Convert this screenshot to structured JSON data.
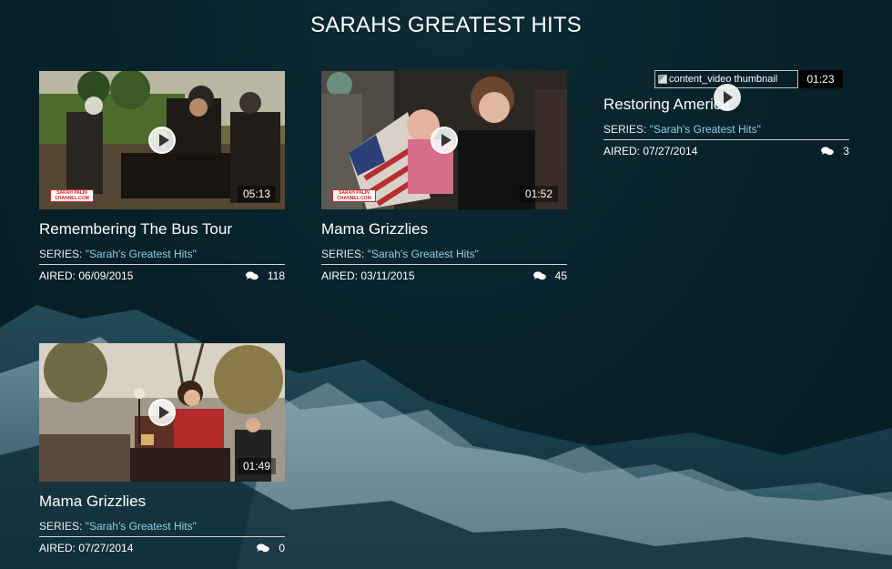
{
  "page": {
    "title": "SARAHS GREATEST HITS"
  },
  "videos": [
    {
      "title": "Remembering The Bus Tour",
      "duration": "05:13",
      "series_label": "SERIES:",
      "series": "\"Sarah's Greatest Hits\"",
      "aired": "AIRED: 06/09/2015",
      "comments": "118",
      "channel_logo": "SARAH PALIN CHANNEL.COM"
    },
    {
      "title": "Mama Grizzlies",
      "duration": "01:52",
      "series_label": "SERIES:",
      "series": "\"Sarah's Greatest Hits\"",
      "aired": "AIRED: 03/11/2015",
      "comments": "45",
      "channel_logo": "SARAH PALIN CHANNEL.COM"
    },
    {
      "title": "Restoring America",
      "duration": "01:23",
      "thumbnail_alt": "content_video thumbnail",
      "series_label": "SERIES:",
      "series": "\"Sarah's Greatest Hits\"",
      "aired": "AIRED: 07/27/2014",
      "comments": "3"
    },
    {
      "title": "Mama Grizzlies",
      "duration": "01:49",
      "series_label": "SERIES:",
      "series": "\"Sarah's Greatest Hits\"",
      "aired": "AIRED: 07/27/2014",
      "comments": "0"
    }
  ],
  "icons": {
    "play": "play-icon",
    "comment": "comment-bubbles-icon"
  },
  "colors": {
    "background": "#07212a",
    "series_link": "#8fd0e2",
    "logo_red": "#c8262c"
  }
}
